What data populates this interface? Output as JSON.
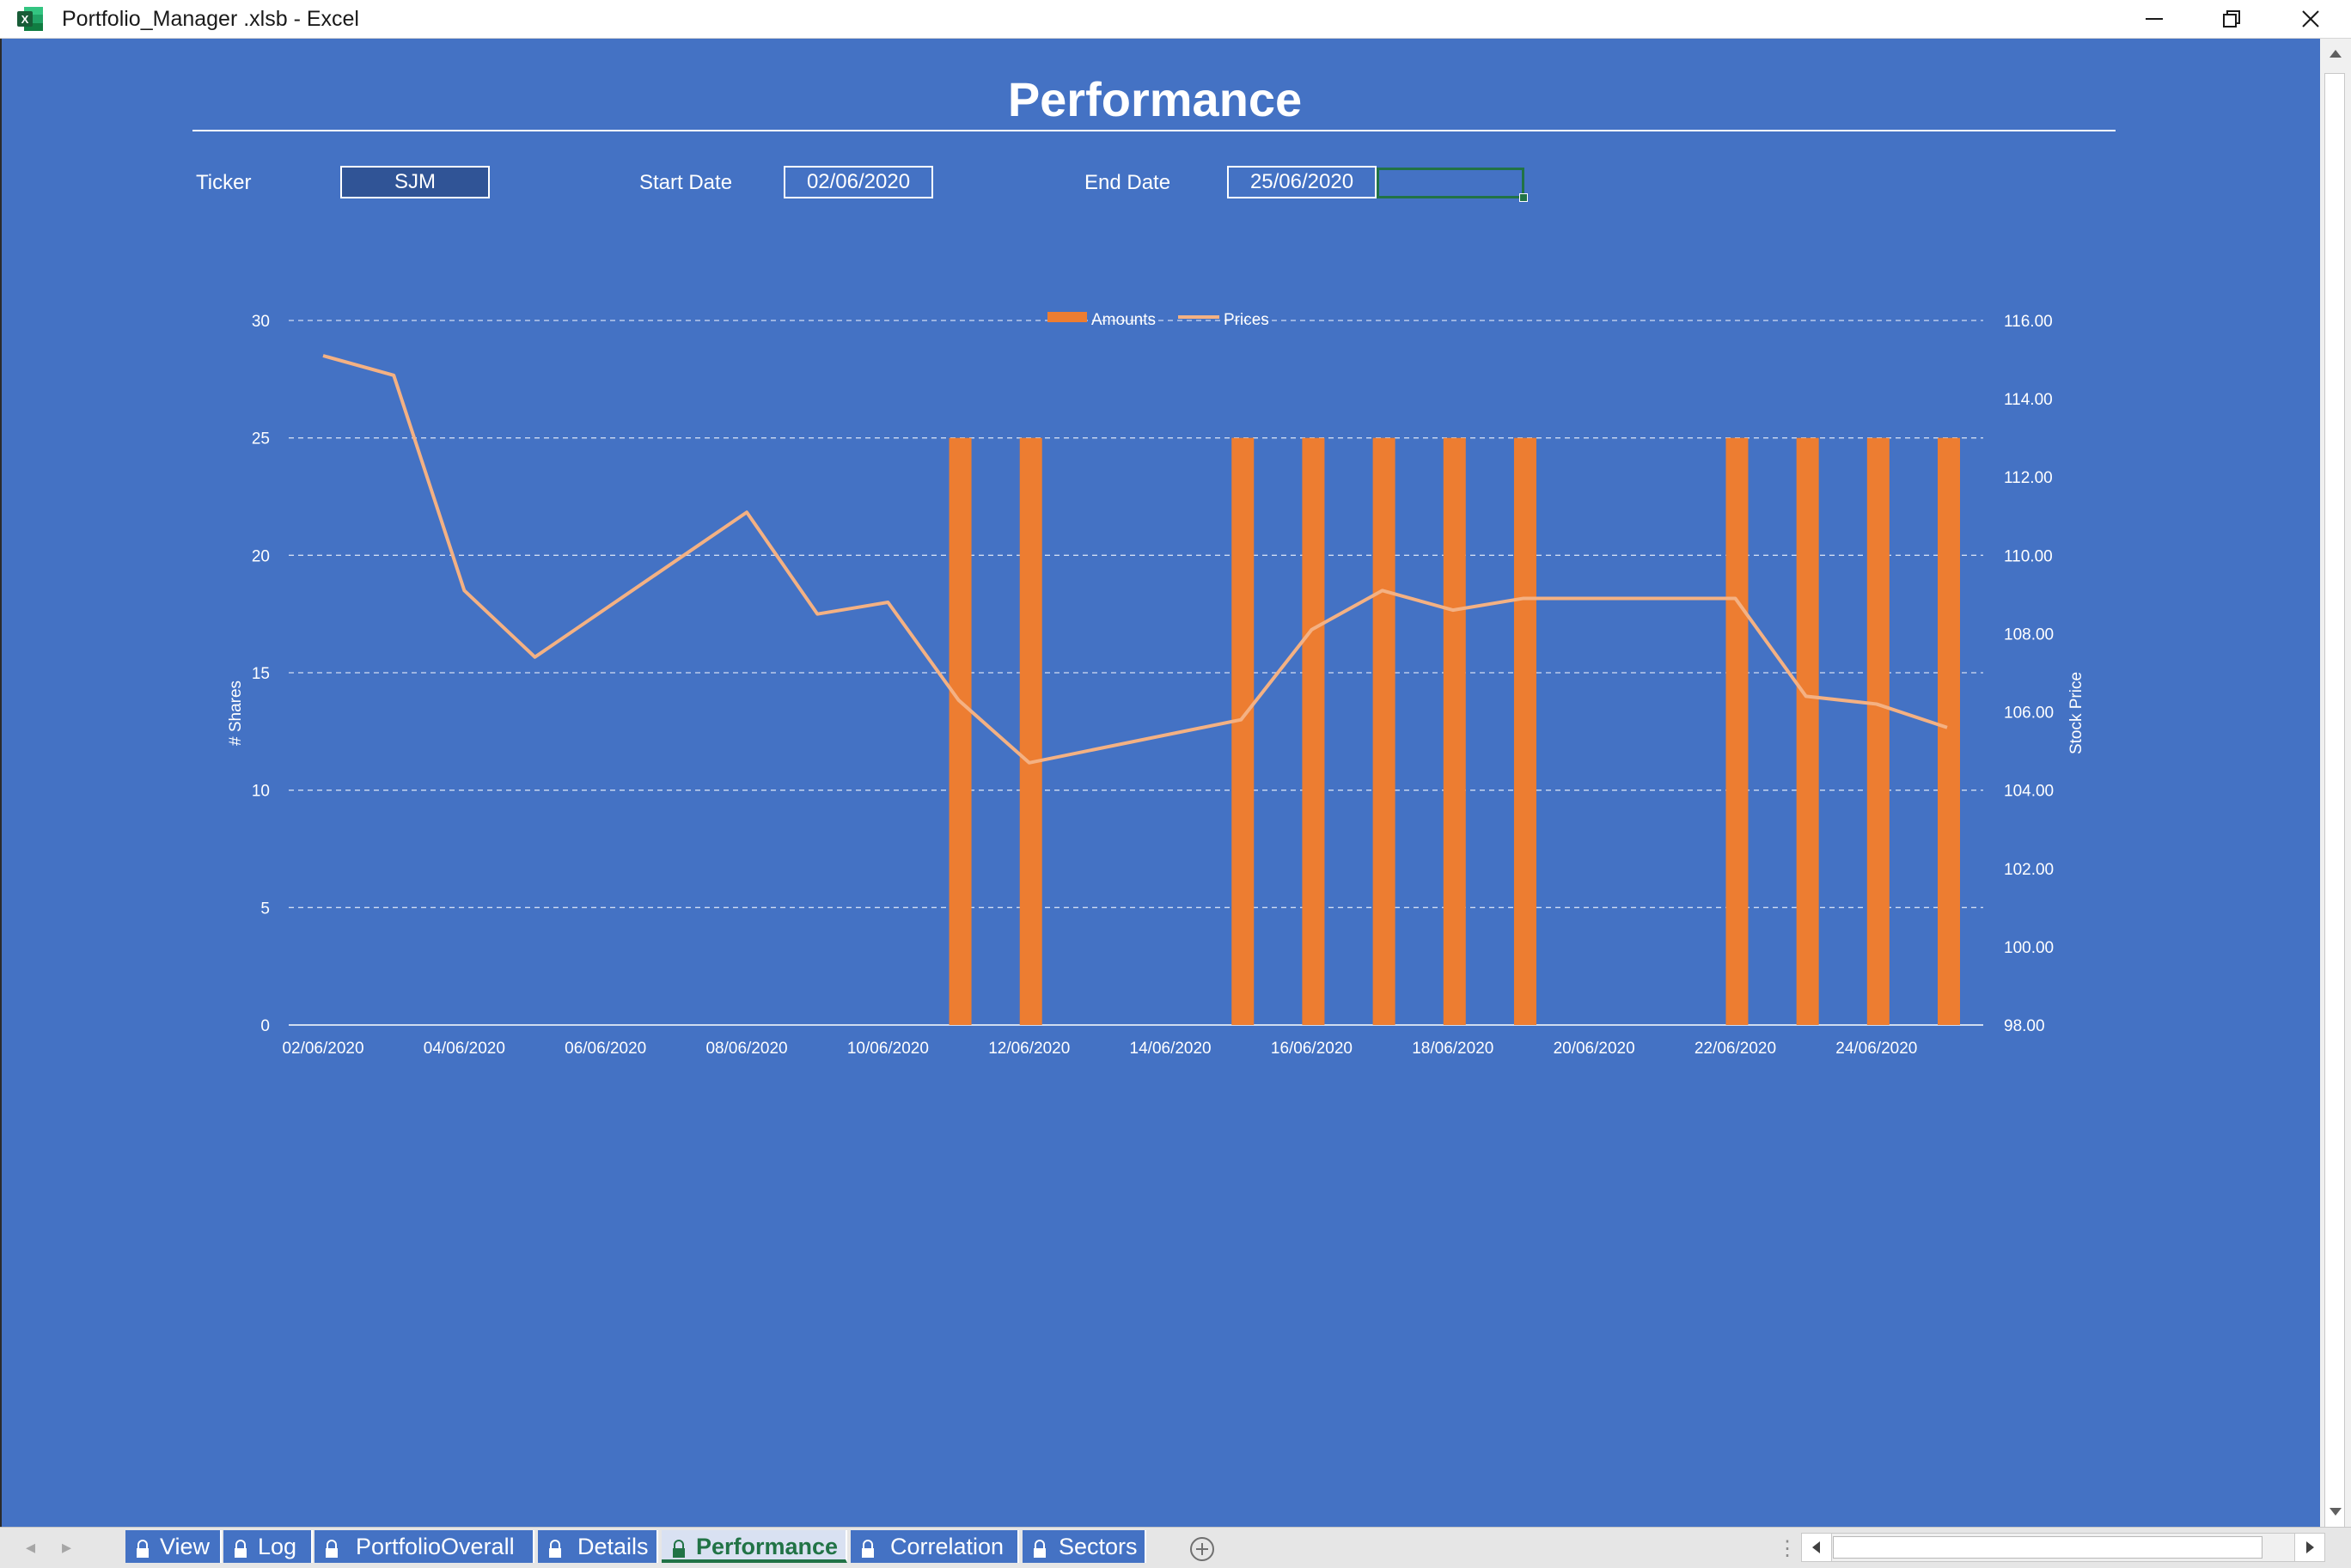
{
  "window": {
    "title": "Portfolio_Manager .xlsb - Excel",
    "app_icon": "excel-icon",
    "controls": [
      "minimize-icon",
      "restore-icon",
      "close-icon"
    ]
  },
  "sheet": {
    "heading": "Performance",
    "background": "#4472c4",
    "fields": {
      "ticker_label": "Ticker",
      "ticker_value": "SJM",
      "start_label": "Start Date",
      "start_value": "02/06/2020",
      "end_label": "End Date",
      "end_value": "25/06/2020"
    }
  },
  "chart_data": {
    "type": "bar",
    "combo": "bar+line",
    "x": [
      "02/06/2020",
      "03/06/2020",
      "04/06/2020",
      "05/06/2020",
      "06/06/2020",
      "07/06/2020",
      "08/06/2020",
      "09/06/2020",
      "10/06/2020",
      "11/06/2020",
      "12/06/2020",
      "13/06/2020",
      "14/06/2020",
      "15/06/2020",
      "16/06/2020",
      "17/06/2020",
      "18/06/2020",
      "19/06/2020",
      "20/06/2020",
      "21/06/2020",
      "22/06/2020",
      "23/06/2020",
      "24/06/2020",
      "25/06/2020"
    ],
    "x_tick_labels": [
      "02/06/2020",
      "04/06/2020",
      "06/06/2020",
      "08/06/2020",
      "10/06/2020",
      "12/06/2020",
      "14/06/2020",
      "16/06/2020",
      "18/06/2020",
      "20/06/2020",
      "22/06/2020",
      "24/06/2020"
    ],
    "series": [
      {
        "name": "Amounts",
        "type": "bar",
        "axis": "left",
        "color": "#ed7d31",
        "values": [
          0,
          0,
          0,
          0,
          0,
          0,
          0,
          0,
          0,
          25,
          25,
          0,
          0,
          25,
          25,
          25,
          25,
          25,
          0,
          0,
          25,
          25,
          25,
          25
        ]
      },
      {
        "name": "Prices",
        "type": "line",
        "axis": "right",
        "color": "#f4b183",
        "values": [
          115.1,
          114.6,
          109.1,
          107.4,
          null,
          null,
          111.1,
          108.5,
          108.8,
          106.3,
          104.7,
          null,
          null,
          105.8,
          108.1,
          109.1,
          108.6,
          108.9,
          null,
          null,
          108.9,
          106.4,
          106.2,
          105.6
        ]
      }
    ],
    "ylabel": "# Shares",
    "ylim": [
      0,
      30
    ],
    "yticks": [
      0,
      5,
      10,
      15,
      20,
      25,
      30
    ],
    "y2label": "Stock Price",
    "y2lim": [
      98,
      116
    ],
    "y2ticks": [
      "98.00",
      "100.00",
      "102.00",
      "104.00",
      "106.00",
      "108.00",
      "110.00",
      "112.00",
      "114.00",
      "116.00"
    ],
    "legend": "top-center",
    "grid": "horizontal dashed"
  },
  "tabs": {
    "items": [
      {
        "label": "View",
        "active": false
      },
      {
        "label": "Log",
        "active": false
      },
      {
        "label": "PortfolioOverall",
        "active": false
      },
      {
        "label": "Details",
        "active": false
      },
      {
        "label": "Performance",
        "active": true
      },
      {
        "label": "Correlation",
        "active": false
      },
      {
        "label": "Sectors",
        "active": false
      }
    ],
    "add_icon": "plus-circle-icon",
    "nav_left": "◂",
    "nav_right": "▸",
    "split_glyph": "⋮"
  }
}
